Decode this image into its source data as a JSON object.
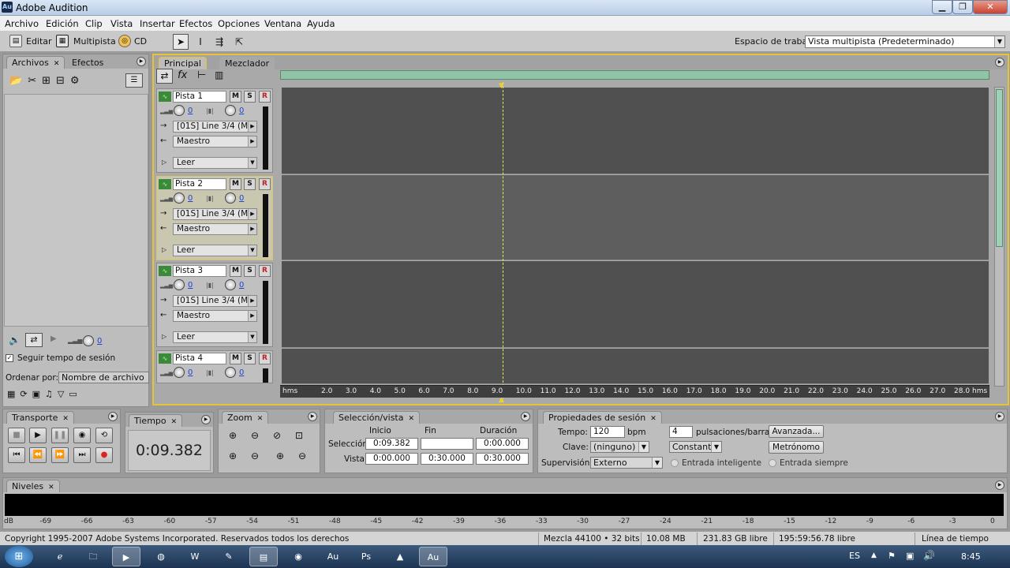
{
  "window": {
    "title": "Adobe Audition",
    "app_badge": "Au"
  },
  "menu": [
    "Archivo",
    "Edición",
    "Clip",
    "Vista",
    "Insertar",
    "Efectos",
    "Opciones",
    "Ventana",
    "Ayuda"
  ],
  "toolbar": {
    "edit_label": "Editar",
    "multitrack_label": "Multipista",
    "cd_label": "CD",
    "workspace_label": "Espacio de trabajo",
    "workspace_value": "Vista multipista (Predeterminado)"
  },
  "files_panel": {
    "tab_files": "Archivos",
    "tab_effects": "Efectos",
    "volume_value": "0",
    "follow_session_tempo": "Seguir tempo de sesión",
    "sort_label": "Ordenar por:",
    "sort_value": "Nombre de archivo"
  },
  "main_panel": {
    "tab_main": "Principal",
    "tab_mixer": "Mezclador"
  },
  "tracks": [
    {
      "name": "Pista 1",
      "vol": "0",
      "pan": "0",
      "input": "[01S] Line 3/4 (M-",
      "output": "Maestro",
      "automation": "Leer"
    },
    {
      "name": "Pista 2",
      "vol": "0",
      "pan": "0",
      "input": "[01S] Line 3/4 (M-",
      "output": "Maestro",
      "automation": "Leer"
    },
    {
      "name": "Pista 3",
      "vol": "0",
      "pan": "0",
      "input": "[01S] Line 3/4 (M-",
      "output": "Maestro",
      "automation": "Leer"
    },
    {
      "name": "Pista 4",
      "vol": "0",
      "pan": "0"
    }
  ],
  "track_buttons": {
    "mute": "M",
    "solo": "S",
    "record": "R"
  },
  "ruler": {
    "unit": "hms",
    "ticks": [
      "2.0",
      "3.0",
      "4.0",
      "5.0",
      "6.0",
      "7.0",
      "8.0",
      "9.0",
      "10.0",
      "11.0",
      "12.0",
      "13.0",
      "14.0",
      "15.0",
      "16.0",
      "17.0",
      "18.0",
      "19.0",
      "20.0",
      "21.0",
      "22.0",
      "23.0",
      "24.0",
      "25.0",
      "26.0",
      "27.0",
      "28.0"
    ]
  },
  "transport": {
    "tab": "Transporte"
  },
  "time": {
    "tab": "Tiempo",
    "value": "0:09.382"
  },
  "zoom": {
    "tab": "Zoom"
  },
  "selection": {
    "tab": "Selección/vista",
    "col_start": "Inicio",
    "col_end": "Fin",
    "col_duration": "Duración",
    "row_selection": "Selección",
    "row_view": "Vista",
    "sel_start": "0:09.382",
    "sel_end": "",
    "sel_duration": "0:00.000",
    "view_start": "0:00.000",
    "view_end": "0:30.000",
    "view_duration": "0:30.000"
  },
  "session": {
    "tab": "Propiedades de sesión",
    "tempo_label": "Tempo:",
    "tempo_value": "120",
    "tempo_unit": "bpm",
    "beats_value": "4",
    "beats_label": "pulsaciones/barra",
    "advanced": "Avanzada...",
    "key_label": "Clave:",
    "key_value": "(ninguno)",
    "mode_value": "Constant",
    "metronome": "Metrónomo",
    "monitor_label": "Supervisión:",
    "monitor_value": "Externo",
    "smart_input": "Entrada inteligente",
    "always_input": "Entrada siempre"
  },
  "levels": {
    "tab": "Niveles",
    "scale": [
      "dB",
      "-69",
      "-66",
      "-63",
      "-60",
      "-57",
      "-54",
      "-51",
      "-48",
      "-45",
      "-42",
      "-39",
      "-36",
      "-33",
      "-30",
      "-27",
      "-24",
      "-21",
      "-18",
      "-15",
      "-12",
      "-9",
      "-6",
      "-3",
      "0"
    ]
  },
  "status": {
    "copyright": "Copyright 1995-2007 Adobe Systems Incorporated. Reservados todos los derechos",
    "mix": "Mezcla 44100 • 32 bits",
    "mem": "10.08 MB",
    "disk": "231.83 GB libre",
    "time_free": "195:59:56.78 libre",
    "view": "Línea de tiempo"
  },
  "taskbar": {
    "lang": "ES",
    "clock": "8:45",
    "active_app": "Au"
  }
}
